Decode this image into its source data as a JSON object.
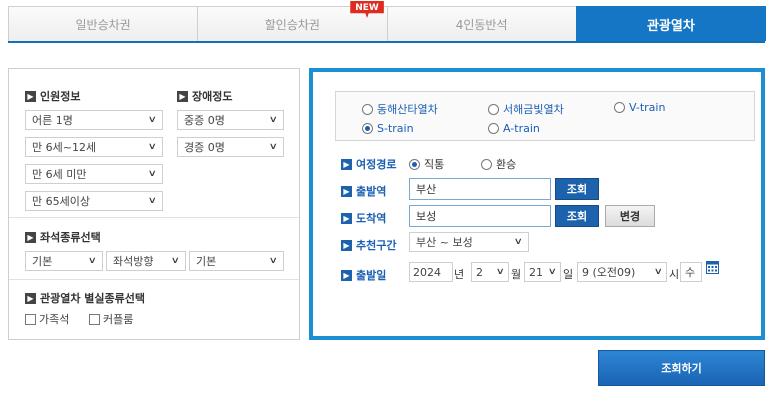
{
  "tabs": [
    {
      "label": "일반승차권"
    },
    {
      "label": "할인승차권",
      "badge": "NEW"
    },
    {
      "label": "4인동반석"
    },
    {
      "label": "관광열차"
    }
  ],
  "passenger": {
    "title": "인원정보",
    "adult": "어른 1명",
    "child": "만 6세~12세",
    "infant": "만 6세 미만",
    "senior": "만 65세이상"
  },
  "disability": {
    "title": "장애정도",
    "severe": "중증 0명",
    "mild": "경증 0명"
  },
  "seat": {
    "title": "좌석종류선택",
    "type": "기본",
    "direction": "좌석방향",
    "position": "기본"
  },
  "special": {
    "title": "관광열차 별실종류선택",
    "family": "가족석",
    "couple": "커플룸"
  },
  "trains": {
    "donghae": "동해산타열차",
    "seohae": "서해금빛열차",
    "vtrain": "V-train",
    "strain": "S-train",
    "atrain": "A-train",
    "selected": "S-train"
  },
  "route": {
    "label": "여정경로",
    "direct": "직통",
    "round": "환승"
  },
  "departure": {
    "label": "출발역",
    "value": "부산",
    "search": "조회"
  },
  "arrival": {
    "label": "도착역",
    "value": "보성",
    "search": "조회",
    "swap": "변경"
  },
  "recommend": {
    "label": "추천구간",
    "value": "부산 ~ 보성"
  },
  "date": {
    "label": "출발일",
    "year": "2024",
    "year_unit": "년",
    "month": "2",
    "month_unit": "월",
    "day": "21",
    "day_unit": "일",
    "hour": "9 (오전09)",
    "hour_unit": "시",
    "weekday": "수"
  },
  "submit": "조회하기"
}
